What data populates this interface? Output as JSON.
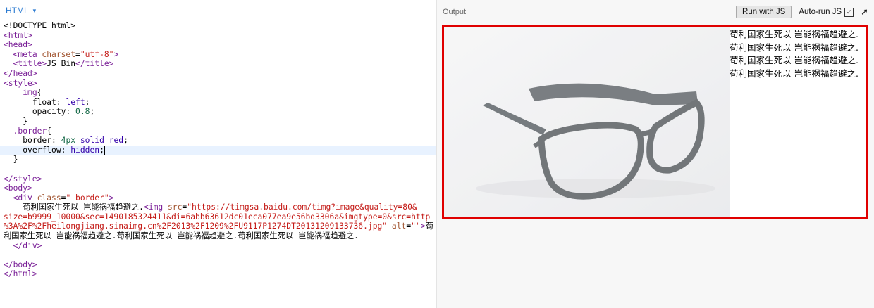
{
  "editor": {
    "language_label": "HTML",
    "lines": [
      {
        "parts": [
          [
            "kw",
            "<!DOCTYPE html>"
          ]
        ]
      },
      {
        "parts": [
          [
            "tag",
            "<html>"
          ]
        ]
      },
      {
        "parts": [
          [
            "tag",
            "<head>"
          ]
        ]
      },
      {
        "parts": [
          [
            "txt",
            "  "
          ],
          [
            "tag",
            "<meta "
          ],
          [
            "attr",
            "charset"
          ],
          [
            "txt",
            "="
          ],
          [
            "str",
            "\"utf-8\""
          ],
          [
            "tag",
            ">"
          ]
        ]
      },
      {
        "parts": [
          [
            "txt",
            "  "
          ],
          [
            "tag",
            "<title>"
          ],
          [
            "txt",
            "JS Bin"
          ],
          [
            "tag",
            "</title>"
          ]
        ]
      },
      {
        "parts": [
          [
            "tag",
            "</head>"
          ]
        ]
      },
      {
        "parts": [
          [
            "tag",
            "<style>"
          ]
        ]
      },
      {
        "parts": [
          [
            "txt",
            "    "
          ],
          [
            "sel",
            "img"
          ],
          [
            "txt",
            "{"
          ]
        ]
      },
      {
        "parts": [
          [
            "txt",
            "      "
          ],
          [
            "prop",
            "float"
          ],
          [
            "txt",
            ": "
          ],
          [
            "val",
            "left"
          ],
          [
            "txt",
            ";"
          ]
        ]
      },
      {
        "parts": [
          [
            "txt",
            "      "
          ],
          [
            "prop",
            "opacity"
          ],
          [
            "txt",
            ": "
          ],
          [
            "num",
            "0.8"
          ],
          [
            "txt",
            ";"
          ]
        ]
      },
      {
        "parts": [
          [
            "txt",
            "    }"
          ]
        ]
      },
      {
        "parts": [
          [
            "txt",
            "  "
          ],
          [
            "sel",
            ".border"
          ],
          [
            "txt",
            "{"
          ]
        ]
      },
      {
        "parts": [
          [
            "txt",
            "    "
          ],
          [
            "prop",
            "border"
          ],
          [
            "txt",
            ": "
          ],
          [
            "num",
            "4px"
          ],
          [
            "txt",
            " "
          ],
          [
            "val",
            "solid"
          ],
          [
            "txt",
            " "
          ],
          [
            "val",
            "red"
          ],
          [
            "txt",
            ";"
          ]
        ]
      },
      {
        "parts": [
          [
            "txt",
            "    "
          ],
          [
            "prop",
            "overflow"
          ],
          [
            "txt",
            ": "
          ],
          [
            "val",
            "hidden"
          ],
          [
            "txt",
            ";"
          ]
        ],
        "active": true
      },
      {
        "parts": [
          [
            "txt",
            "  }"
          ]
        ]
      },
      {
        "parts": [
          [
            "txt",
            ""
          ]
        ]
      },
      {
        "parts": [
          [
            "tag",
            "</style>"
          ]
        ]
      },
      {
        "parts": [
          [
            "tag",
            "<body>"
          ]
        ]
      },
      {
        "parts": [
          [
            "txt",
            "  "
          ],
          [
            "tag",
            "<div "
          ],
          [
            "attr",
            "class"
          ],
          [
            "txt",
            "="
          ],
          [
            "str",
            "\" border\""
          ],
          [
            "tag",
            ">"
          ]
        ]
      },
      {
        "parts": [
          [
            "txt",
            "    苟利国家生死以 岂能祸福趋避之."
          ],
          [
            "tag",
            "<img "
          ],
          [
            "attr",
            "src"
          ],
          [
            "txt",
            "="
          ],
          [
            "str",
            "\"https://timgsa.baidu.com/timg?image&quality=80&"
          ]
        ]
      },
      {
        "parts": [
          [
            "str",
            "size=b9999_10000&sec=1490185324411&di=6abb63612dc01eca077ea9e56bd3306a&imgtype=0&src=http"
          ]
        ]
      },
      {
        "parts": [
          [
            "str",
            "%3A%2F%2Fheilongjiang.sinaimg.cn%2F2013%2F1209%2FU9117P1274DT20131209133736.jpg\""
          ],
          [
            "txt",
            " "
          ],
          [
            "attr",
            "alt"
          ],
          [
            "txt",
            "="
          ],
          [
            "str",
            "\"\""
          ],
          [
            "tag",
            ">"
          ],
          [
            "txt",
            "苟"
          ]
        ]
      },
      {
        "parts": [
          [
            "txt",
            "利国家生死以 岂能祸福趋避之.苟利国家生死以 岂能祸福趋避之.苟利国家生死以 岂能祸福趋避之."
          ]
        ]
      },
      {
        "parts": [
          [
            "txt",
            "  "
          ],
          [
            "tag",
            "</div>"
          ]
        ]
      },
      {
        "parts": [
          [
            "txt",
            ""
          ]
        ]
      },
      {
        "parts": [
          [
            "tag",
            "</body>"
          ]
        ]
      },
      {
        "parts": [
          [
            "tag",
            "</html>"
          ]
        ]
      }
    ]
  },
  "output": {
    "title": "Output",
    "run_button": "Run with JS",
    "autorun_label": "Auto-run JS",
    "autorun_checked": true,
    "frame_lines": [
      "苟利国家生死以 岂能祸福趋避之.",
      "苟利国家生死以 岂能祸福趋避之.",
      "苟利国家生死以 岂能祸福趋避之.",
      "苟利国家生死以 岂能祸福趋避之."
    ],
    "border_color": "#e00000"
  }
}
